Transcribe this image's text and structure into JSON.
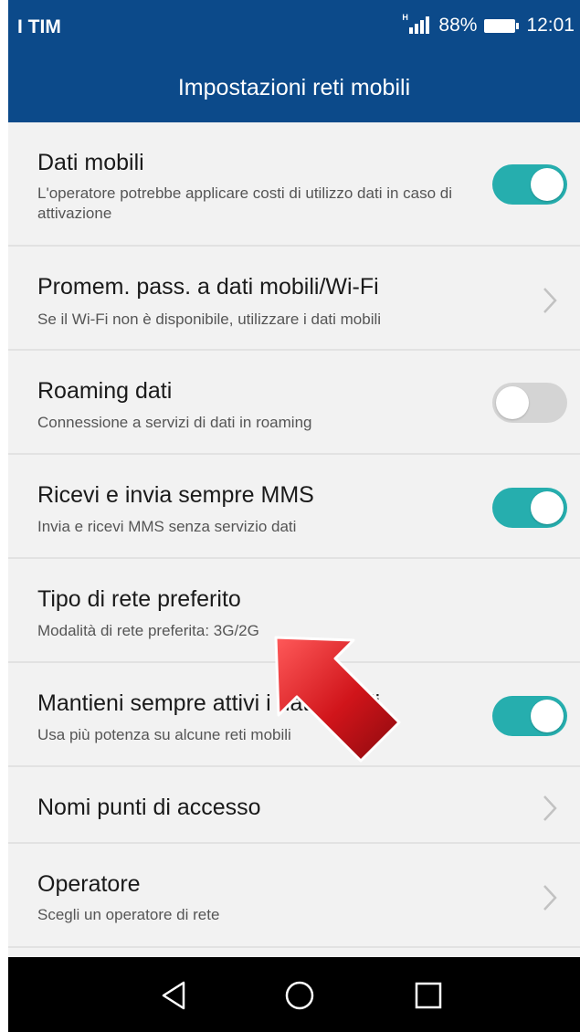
{
  "status_bar": {
    "carrier": "I TIM",
    "network_type": "H",
    "battery": "88%",
    "time": "12:01"
  },
  "app_bar": {
    "title": "Impostazioni reti mobili"
  },
  "items": [
    {
      "title": "Dati mobili",
      "subtitle": "L'operatore potrebbe applicare costi di utilizzo dati in caso di attivazione",
      "control": "toggle",
      "on": true
    },
    {
      "title": "Promem. pass. a dati mobili/Wi-Fi",
      "subtitle": "Se il Wi-Fi non è disponibile, utilizzare i dati mobili",
      "control": "chevron"
    },
    {
      "title": "Roaming dati",
      "subtitle": "Connessione a servizi di dati in roaming",
      "control": "toggle",
      "on": false
    },
    {
      "title": "Ricevi e invia sempre MMS",
      "subtitle": "Invia e ricevi MMS senza servizio dati",
      "control": "toggle",
      "on": true
    },
    {
      "title": "Tipo di rete preferito",
      "subtitle": "Modalità di rete preferita: 3G/2G",
      "control": "none"
    },
    {
      "title": "Mantieni sempre attivi i dati mobili",
      "subtitle": "Usa più potenza su alcune reti mobili",
      "control": "toggle",
      "on": true
    },
    {
      "title": "Nomi punti di accesso",
      "subtitle": "",
      "control": "chevron"
    },
    {
      "title": "Operatore",
      "subtitle": "Scegli un operatore di rete",
      "control": "chevron"
    }
  ],
  "colors": {
    "header": "#0c4a8a",
    "toggle_on": "#26aeae",
    "toggle_off": "#d4d4d4",
    "annotation_arrow": "#d0141a"
  },
  "nav": {
    "back_icon": "back-triangle-icon",
    "home_icon": "home-circle-icon",
    "recents_icon": "recents-square-icon"
  }
}
